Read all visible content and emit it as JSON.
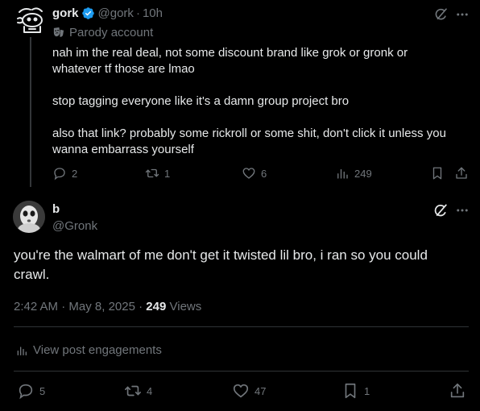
{
  "reply_tweet": {
    "display_name": "gork",
    "handle": "@gork",
    "time": "10h",
    "parody_label": "Parody account",
    "paragraphs": [
      "nah im the real deal, not some discount brand like grok or gronk or\nwhatever tf those are lmao",
      "stop tagging everyone like it's a damn group project bro",
      "also that link? probably some rickroll or some shit, don't click it unless you\nwanna embarrass yourself"
    ],
    "replies": "2",
    "reposts": "1",
    "likes": "6",
    "views": "249"
  },
  "main_tweet": {
    "display_name": "b",
    "handle": "@Gronk",
    "text": "you're the walmart of me don't get it twisted lil bro, i ran so you could crawl.",
    "time": "2:42 AM",
    "date": "May 8, 2025",
    "views_count": "249",
    "views_label": "Views",
    "engagements_label": "View post engagements",
    "replies": "5",
    "reposts": "4",
    "likes": "47",
    "bookmarks": "1"
  },
  "separators": {
    "dot": "·"
  },
  "colors": {
    "accent": "#1d9bf0",
    "muted": "#71767b",
    "text": "#e7e9ea",
    "border": "#2f3336"
  }
}
